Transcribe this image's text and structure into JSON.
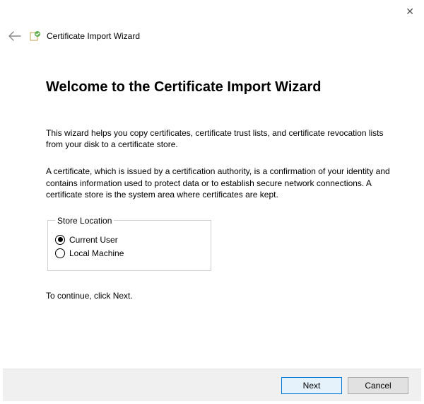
{
  "header": {
    "title": "Certificate Import Wizard"
  },
  "page": {
    "title": "Welcome to the Certificate Import Wizard",
    "paragraph1": "This wizard helps you copy certificates, certificate trust lists, and certificate revocation lists from your disk to a certificate store.",
    "paragraph2": "A certificate, which is issued by a certification authority, is a confirmation of your identity and contains information used to protect data or to establish secure network connections. A certificate store is the system area where certificates are kept.",
    "storeLocation": {
      "legend": "Store Location",
      "options": {
        "currentUser": "Current User",
        "localMachine": "Local Machine"
      }
    },
    "continueText": "To continue, click Next."
  },
  "footer": {
    "next": "Next",
    "cancel": "Cancel"
  }
}
